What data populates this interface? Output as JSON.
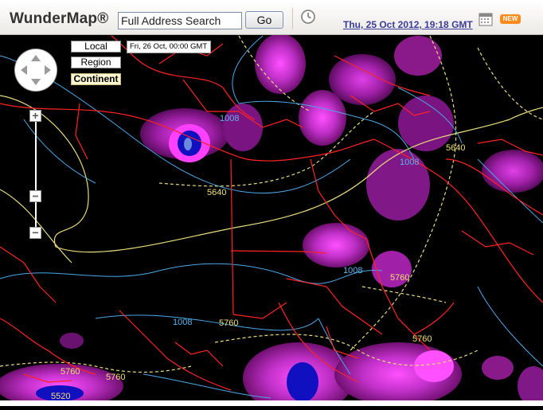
{
  "header": {
    "logo": "WunderMap®",
    "search": {
      "value": "Full Address Search"
    },
    "go_label": "Go",
    "datetime": "Thu, 25 Oct 2012, 19:18 GMT",
    "new_badge": "NEW"
  },
  "scope": {
    "local": "Local",
    "region": "Region",
    "continent": "Continent",
    "selected": "Continent"
  },
  "map": {
    "forecast_time": "Fri, 26 Oct, 00:00 GMT",
    "labels": {
      "h5640_a": "5640",
      "h5640_b": "5640",
      "h5760_a": "5760",
      "h5760_b": "5760",
      "h5760_c": "5760",
      "h5760_d": "5760",
      "h5760_e": "5760",
      "h5520": "5520",
      "p1008_a": "1008",
      "p1008_b": "1008",
      "p1008_c": "1008",
      "p1008_d": "1008"
    },
    "colors": {
      "background": "#000000",
      "borders": "#ff2222",
      "height_contours": "#e8dc7a",
      "pressure_isobars": "#4aa8e8",
      "precip_light": "#8a1a8a",
      "precip_medium": "#c030c8",
      "precip_heavy": "#ff40ff",
      "precip_extreme": "#1010c0"
    }
  },
  "zoom": {
    "in_icon": "+",
    "out_icon": "−"
  }
}
